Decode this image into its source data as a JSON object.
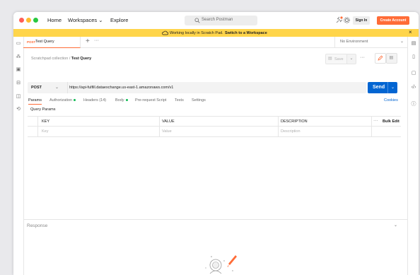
{
  "titlebar": {
    "home": "Home",
    "workspaces": "Workspaces",
    "explore": "Explore",
    "search_placeholder": "Search Postman",
    "sign_in": "Sign In",
    "create_account": "Create Account"
  },
  "banner": {
    "text": "Working locally in Scratch Pad.",
    "link": "Switch to a Workspace"
  },
  "tab": {
    "method": "POST",
    "name": "Test Query"
  },
  "environment": "No Environment",
  "breadcrumb": {
    "collection": "Scratchpad collection",
    "separator": "/",
    "request": "Test Query"
  },
  "toolbar": {
    "save": "Save"
  },
  "request": {
    "method": "POST",
    "url": "https://api-fulfill.dataexchange.us-east-1.amazonaws.com/v1",
    "send": "Send"
  },
  "subtabs": {
    "params": "Params",
    "authorization": "Authorization",
    "headers": "Headers (14)",
    "body": "Body",
    "prerequest": "Pre-request Script",
    "tests": "Tests",
    "settings": "Settings",
    "cookies": "Cookies"
  },
  "query_params": {
    "title": "Query Params",
    "headers": [
      "KEY",
      "VALUE",
      "DESCRIPTION"
    ],
    "bulk_edit": "Bulk Edit",
    "placeholders": [
      "Key",
      "Value",
      "Description"
    ]
  },
  "response": {
    "label": "Response"
  },
  "colors": {
    "accent": "#ff6c37",
    "send": "#0265d2",
    "banner": "#ffd54a",
    "active_dot": "#0cbb52"
  }
}
